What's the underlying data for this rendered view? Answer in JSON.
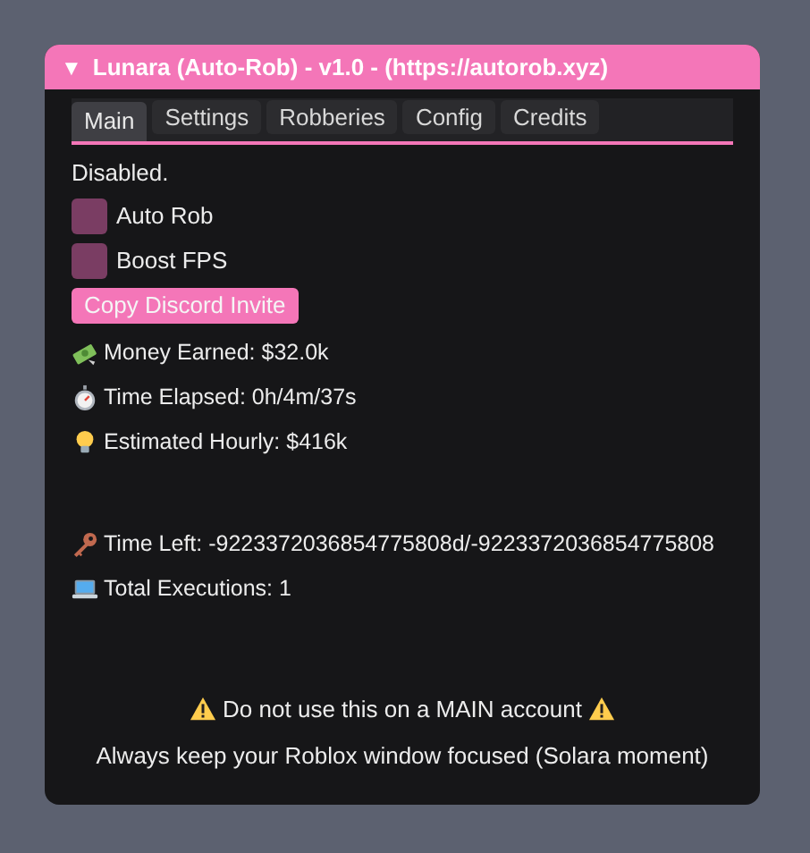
{
  "window": {
    "title": "Lunara (Auto-Rob) - v1.0 - (https://autorob.xyz)",
    "collapse_glyph": "▼"
  },
  "tabs": [
    {
      "label": "Main",
      "selected": true
    },
    {
      "label": "Settings",
      "selected": false
    },
    {
      "label": "Robberies",
      "selected": false
    },
    {
      "label": "Config",
      "selected": false
    },
    {
      "label": "Credits",
      "selected": false
    }
  ],
  "status": "Disabled.",
  "toggles": [
    {
      "label": "Auto Rob",
      "checked": false
    },
    {
      "label": "Boost FPS",
      "checked": false
    }
  ],
  "button": "Copy Discord Invite",
  "stats": [
    {
      "kind": "money",
      "text": "Money Earned: $32.0k"
    },
    {
      "kind": "stopwatch",
      "text": "Time Elapsed: 0h/4m/37s"
    },
    {
      "kind": "bulb",
      "text": "Estimated Hourly: $416k"
    },
    {
      "kind": "spacer"
    },
    {
      "kind": "key",
      "text": "Time Left: -9223372036854775808d/-9223372036854775808"
    },
    {
      "kind": "laptop",
      "text": "Total Executions: 1"
    }
  ],
  "warning": "Do not use this on a MAIN account",
  "note": "Always keep your Roblox window focused (Solara moment)"
}
